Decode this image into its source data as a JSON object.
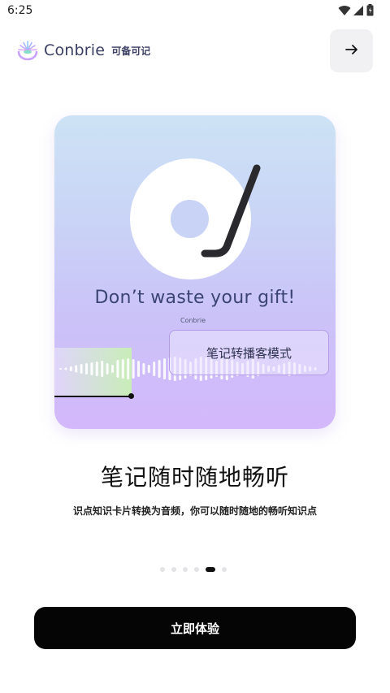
{
  "status_bar": {
    "time": "6:25",
    "icons": [
      "wifi-icon",
      "signal-icon",
      "battery-icon"
    ]
  },
  "brand": {
    "name": "Conbrie",
    "name_cn": "可备可记"
  },
  "next_button": {
    "icon": "arrow-right-icon"
  },
  "card": {
    "slogan": "Don’t waste your gift!",
    "mini_brand": "Conbrie",
    "mode_label": "笔记转播客模式",
    "colors": {
      "gradient_top": "#cde3f5",
      "gradient_bottom": "#d3b8fb",
      "accent_border": "#b49ae8"
    }
  },
  "headline": "笔记随时随地畅听",
  "subtext": "识点知识卡片转换为音频，你可以随时随地的畅听知识点",
  "pagination": {
    "count": 6,
    "active_index": 4
  },
  "cta": {
    "label": "立即体验"
  }
}
